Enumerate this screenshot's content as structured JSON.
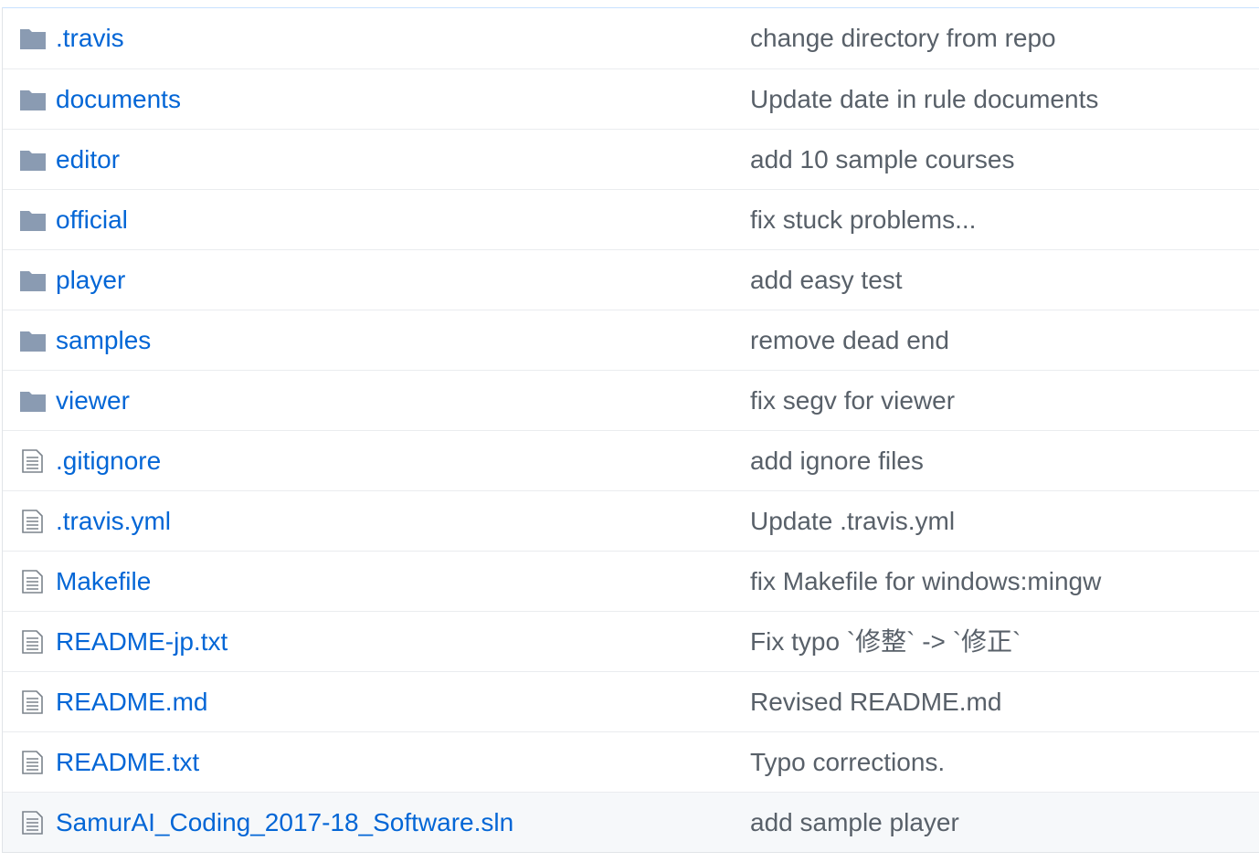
{
  "colors": {
    "link": "#0366d6",
    "message": "#586069",
    "folder_icon": "#79b8ff",
    "file_icon": "#6a737d",
    "row_border": "#eaecef",
    "hover_row": "#f6f8fa"
  },
  "files": [
    {
      "icon": "folder-icon",
      "name": ".travis",
      "message": "change directory from repo"
    },
    {
      "icon": "folder-icon",
      "name": "documents",
      "message": "Update date in rule documents"
    },
    {
      "icon": "folder-icon",
      "name": "editor",
      "message": "add 10 sample courses"
    },
    {
      "icon": "folder-icon",
      "name": "official",
      "message": "fix stuck problems..."
    },
    {
      "icon": "folder-icon",
      "name": "player",
      "message": "add easy test"
    },
    {
      "icon": "folder-icon",
      "name": "samples",
      "message": "remove dead end"
    },
    {
      "icon": "folder-icon",
      "name": "viewer",
      "message": "fix segv for viewer"
    },
    {
      "icon": "file-icon",
      "name": ".gitignore",
      "message": "add ignore files"
    },
    {
      "icon": "file-icon",
      "name": ".travis.yml",
      "message": "Update .travis.yml"
    },
    {
      "icon": "file-icon",
      "name": "Makefile",
      "message": "fix Makefile for windows:mingw"
    },
    {
      "icon": "file-icon",
      "name": "README-jp.txt",
      "message": "Fix typo `修整` -> `修正`"
    },
    {
      "icon": "file-icon",
      "name": "README.md",
      "message": "Revised README.md"
    },
    {
      "icon": "file-icon",
      "name": "README.txt",
      "message": "Typo corrections."
    },
    {
      "icon": "file-icon",
      "name": "SamurAI_Coding_2017-18_Software.sln",
      "message": "add sample player",
      "hovered": true
    }
  ]
}
